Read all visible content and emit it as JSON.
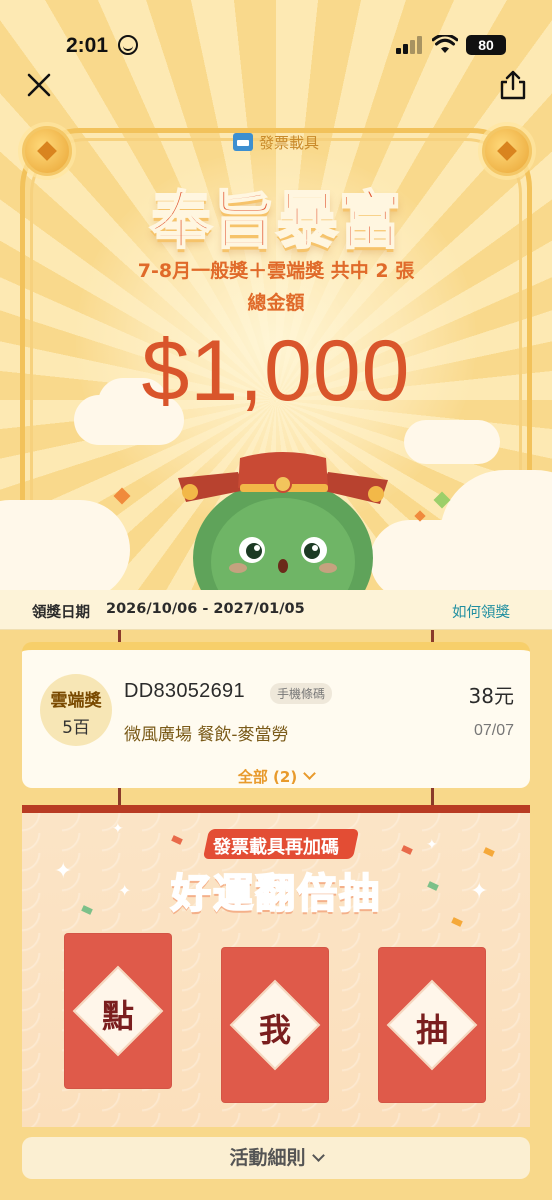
{
  "status_bar": {
    "time": "2:01",
    "battery": "80"
  },
  "hero": {
    "carrier_tag": "發票載具",
    "headline": "奉旨暴富",
    "subline": "7-8月一般獎＋雲端獎 共中 2 張",
    "total_label": "總金額",
    "total_amount": "$1,000"
  },
  "claim": {
    "label": "領獎日期",
    "dates": "2026/10/06 - 2027/01/05",
    "how_link": "如何領獎"
  },
  "invoice": {
    "prize_line1": "雲端獎",
    "prize_line2": "5百",
    "number": "DD83052691",
    "tag": "手機條碼",
    "amount": "38元",
    "store": "微風廣場 餐飲-麥當勞",
    "date": "07/07",
    "all_label": "全部 (2)"
  },
  "draw": {
    "subtitle": "發票載具再加碼",
    "title": "好運翻倍抽",
    "envelopes": [
      {
        "char": "點"
      },
      {
        "char": "我"
      },
      {
        "char": "抽"
      }
    ]
  },
  "details_button": "活動細則",
  "colors": {
    "accent_red": "#e0532e",
    "envelope_red": "#df5a4a",
    "link_teal": "#1f8ea0",
    "background_gold": "#f8d88a"
  }
}
